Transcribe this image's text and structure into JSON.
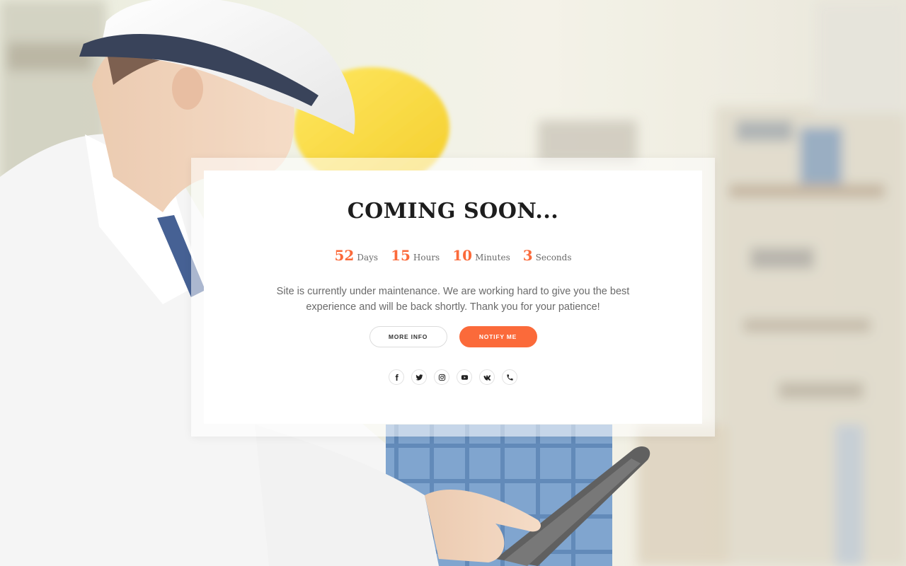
{
  "page": {
    "title": "COMING SOON...",
    "message": "Site is currently under maintenance. We are working hard to give you the best experience and will be back shortly. Thank you for your patience!"
  },
  "countdown": {
    "days": {
      "value": "52",
      "label": "Days"
    },
    "hours": {
      "value": "15",
      "label": "Hours"
    },
    "minutes": {
      "value": "10",
      "label": "Minutes"
    },
    "seconds": {
      "value": "3",
      "label": "Seconds"
    }
  },
  "buttons": {
    "more_info": "MORE INFO",
    "notify_me": "NOTIFY ME"
  },
  "social": [
    {
      "icon": "facebook-icon"
    },
    {
      "icon": "twitter-icon"
    },
    {
      "icon": "instagram-icon"
    },
    {
      "icon": "youtube-icon"
    },
    {
      "icon": "vk-icon"
    },
    {
      "icon": "phone-icon"
    }
  ],
  "colors": {
    "accent": "#fb6a3a",
    "title": "#1d1d1d",
    "body_text": "#6a6a6a",
    "card_bg": "#ffffff"
  }
}
